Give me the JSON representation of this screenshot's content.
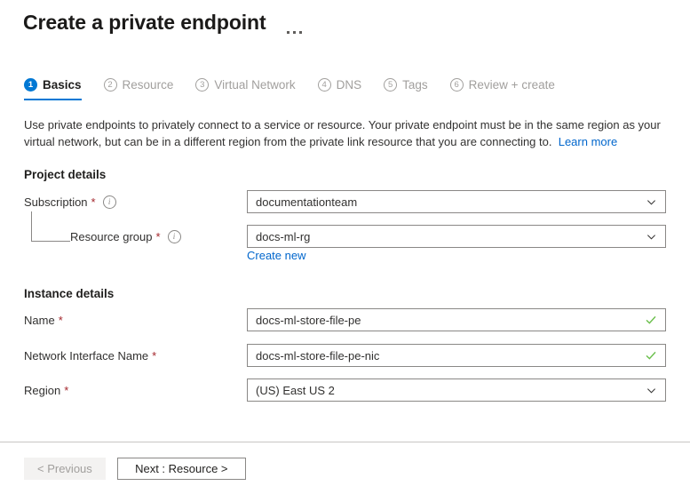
{
  "header": {
    "title": "Create a private endpoint",
    "more_options_label": "..."
  },
  "steps": [
    {
      "number": "1",
      "label": "Basics",
      "state": "active"
    },
    {
      "number": "2",
      "label": "Resource",
      "state": "inactive"
    },
    {
      "number": "3",
      "label": "Virtual Network",
      "state": "inactive"
    },
    {
      "number": "4",
      "label": "DNS",
      "state": "inactive"
    },
    {
      "number": "5",
      "label": "Tags",
      "state": "inactive"
    },
    {
      "number": "6",
      "label": "Review + create",
      "state": "inactive"
    }
  ],
  "description": {
    "text": "Use private endpoints to privately connect to a service or resource. Your private endpoint must be in the same region as your virtual network, but can be in a different region from the private link resource that you are connecting to.",
    "link_label": "Learn more"
  },
  "project_details": {
    "section_title": "Project details",
    "subscription": {
      "label": "Subscription",
      "required": "*",
      "info_icon": "info-icon",
      "value": "documentationteam",
      "control": "dropdown"
    },
    "resource_group": {
      "label": "Resource group",
      "required": "*",
      "info_icon": "info-icon",
      "value": "docs-ml-rg",
      "control": "dropdown",
      "create_new_label": "Create new"
    }
  },
  "instance_details": {
    "section_title": "Instance details",
    "name": {
      "label": "Name",
      "required": "*",
      "value": "docs-ml-store-file-pe",
      "control": "textbox",
      "validation": "valid-check-icon"
    },
    "network_interface_name": {
      "label": "Network Interface Name",
      "required": "*",
      "value": "docs-ml-store-file-pe-nic",
      "control": "textbox",
      "validation": "valid-check-icon"
    },
    "region": {
      "label": "Region",
      "required": "*",
      "value": "(US) East US 2",
      "control": "dropdown"
    }
  },
  "footer": {
    "previous_label": "< Previous",
    "next_label": "Next : Resource >"
  },
  "colors": {
    "accent": "#0078d4",
    "link": "#0066cc",
    "required_asterisk": "#a4262c",
    "validation_green": "#6abf4b",
    "border": "#8a8886",
    "disabled_text": "#a19f9d"
  }
}
